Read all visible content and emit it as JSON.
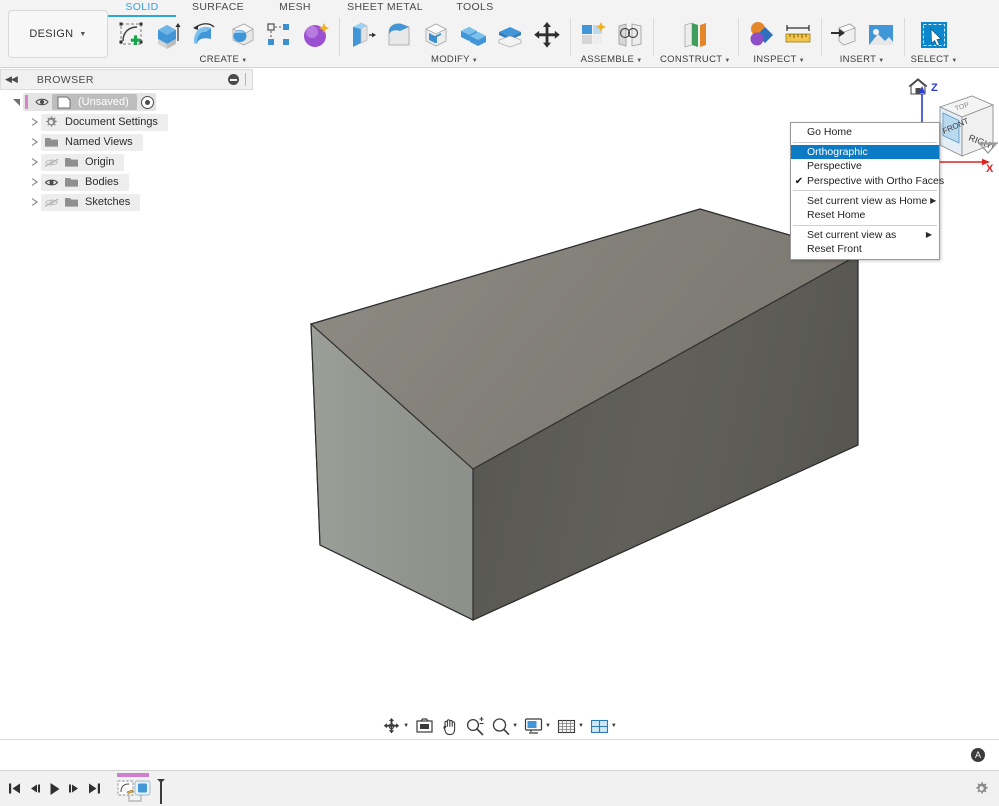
{
  "app": {
    "title": "Fusion 360",
    "accent": "#2fa8cf",
    "ribbon_bg": "#f3f3f3",
    "selection_blue": "#0a7bc4"
  },
  "ribbon": {
    "workspace_label": "DESIGN",
    "tabs": [
      {
        "label": "SOLID",
        "active": true
      },
      {
        "label": "SURFACE",
        "active": false
      },
      {
        "label": "MESH",
        "active": false
      },
      {
        "label": "SHEET METAL",
        "active": false
      },
      {
        "label": "TOOLS",
        "active": false
      }
    ],
    "panels": [
      {
        "label": "CREATE",
        "has_caret": true,
        "icons": [
          "create-sketch-icon",
          "extrude-icon",
          "revolve-icon",
          "sweep-icon",
          "pattern-icon",
          "form-icon"
        ]
      },
      {
        "label": "MODIFY",
        "has_caret": true,
        "icons": [
          "press-pull-icon",
          "fillet-icon",
          "shell-icon",
          "combine-icon",
          "split-face-icon",
          "move-copy-icon"
        ]
      },
      {
        "label": "ASSEMBLE",
        "has_caret": true,
        "icons": [
          "new-component-icon",
          "joint-icon"
        ]
      },
      {
        "label": "CONSTRUCT",
        "has_caret": true,
        "icons": [
          "offset-plane-icon"
        ]
      },
      {
        "label": "INSPECT",
        "has_caret": true,
        "icons": [
          "interference-icon",
          "measure-icon"
        ]
      },
      {
        "label": "INSERT",
        "has_caret": true,
        "icons": [
          "insert-derive-icon",
          "insert-canvas-icon"
        ]
      },
      {
        "label": "SELECT",
        "has_caret": true,
        "icons": [
          "select-cursor-icon"
        ]
      }
    ]
  },
  "browser": {
    "title": "BROWSER",
    "collapse_icon": "collapse-left-icon",
    "minimize_icon": "minus-circle-icon",
    "root": {
      "label": "(Unsaved)",
      "expanded": true,
      "doc_icon": "document-icon",
      "radio_icon": "active-component-radio-icon"
    },
    "items": [
      {
        "label": "Document Settings",
        "icon": "gear-icon",
        "eye": "none",
        "expanded": false
      },
      {
        "label": "Named Views",
        "icon": "folder-icon",
        "eye": "none",
        "expanded": false
      },
      {
        "label": "Origin",
        "icon": "folder-icon",
        "eye": "hidden",
        "expanded": false
      },
      {
        "label": "Bodies",
        "icon": "folder-icon",
        "eye": "visible",
        "expanded": false
      },
      {
        "label": "Sketches",
        "icon": "folder-icon",
        "eye": "hidden",
        "expanded": false
      }
    ]
  },
  "canvas": {
    "background": "#ffffff",
    "body": {
      "name": "box-body",
      "face_top_color": "#85827a",
      "face_left_color": "#919490",
      "face_right_color": "#5d5c57",
      "edge_color": "#2f2f2f"
    }
  },
  "viewcube": {
    "home_icon": "home-icon",
    "faces": {
      "front": "FRONT",
      "right": "RIGHT",
      "top": "TOP"
    },
    "axes": [
      {
        "label": "Z",
        "color": "#2b3fd0"
      },
      {
        "label": "X",
        "color": "#e02222"
      }
    ],
    "orbit_icon": "orbit-chevron-icon"
  },
  "context_menu": {
    "name": "viewcube-context-menu",
    "items": [
      {
        "label": "Go Home",
        "checked": false,
        "selected": false,
        "submenu": false
      },
      {
        "label": "Orthographic",
        "checked": false,
        "selected": true,
        "submenu": false
      },
      {
        "label": "Perspective",
        "checked": false,
        "selected": false,
        "submenu": false
      },
      {
        "label": "Perspective with Ortho Faces",
        "checked": true,
        "selected": false,
        "submenu": false
      },
      {
        "separator": true
      },
      {
        "label": "Set current view as Home",
        "checked": false,
        "selected": false,
        "submenu": true
      },
      {
        "label": "Reset Home",
        "checked": false,
        "selected": false,
        "submenu": false
      },
      {
        "separator": true
      },
      {
        "label": "Set current view as",
        "checked": false,
        "selected": false,
        "submenu": true
      },
      {
        "label": "Reset Front",
        "checked": false,
        "selected": false,
        "submenu": false
      }
    ]
  },
  "navbar": {
    "items": [
      {
        "name": "orbit-icon",
        "caret": true
      },
      {
        "name": "look-at-icon",
        "caret": false
      },
      {
        "name": "pan-icon",
        "caret": false
      },
      {
        "name": "zoom-icon",
        "caret": false
      },
      {
        "name": "zoom-window-icon",
        "caret": true
      },
      {
        "name": "display-settings-icon",
        "caret": true
      },
      {
        "name": "grid-snaps-icon",
        "caret": true
      },
      {
        "name": "viewports-icon",
        "caret": true
      }
    ]
  },
  "statusbar": {
    "badge": "A",
    "badge_name": "autodesk-account-badge"
  },
  "timeline": {
    "controls": [
      {
        "name": "go-to-beginning-icon"
      },
      {
        "name": "step-back-icon"
      },
      {
        "name": "play-icon"
      },
      {
        "name": "step-forward-icon"
      },
      {
        "name": "go-to-end-icon"
      }
    ],
    "features": [
      {
        "name": "sketch-feature-node"
      },
      {
        "name": "extrude-feature-node"
      }
    ],
    "settings_icon": "gear-icon"
  }
}
